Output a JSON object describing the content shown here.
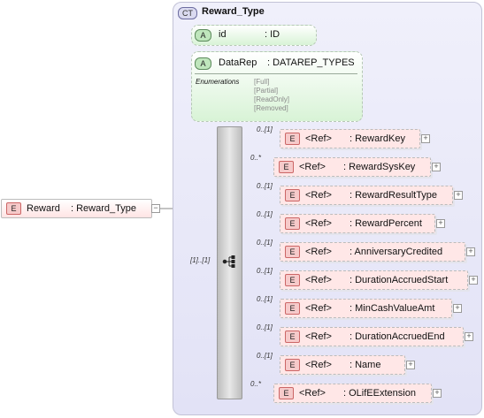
{
  "complex_type": {
    "badge": "CT",
    "name": "Reward_Type"
  },
  "root_element": {
    "badge": "E",
    "name": "Reward",
    "type": ": Reward_Type"
  },
  "attributes": [
    {
      "badge": "A",
      "name": "id",
      "type": ": ID"
    },
    {
      "badge": "A",
      "name": "DataRep",
      "type": ": DATAREP_TYPES",
      "enumerations_label": "Enumerations",
      "enumerations": [
        "[Full]",
        "[Partial]",
        "[ReadOnly]",
        "[Removed]"
      ]
    }
  ],
  "sequence": {
    "multiplicity": "[1]..[1]",
    "icon": "sequence-icon"
  },
  "elements": [
    {
      "mult": "0..[1]",
      "ref": "<Ref>",
      "name": ": RewardKey"
    },
    {
      "mult": "0..*",
      "ref": "<Ref>",
      "name": ": RewardSysKey"
    },
    {
      "mult": "0..[1]",
      "ref": "<Ref>",
      "name": ": RewardResultType"
    },
    {
      "mult": "0..[1]",
      "ref": "<Ref>",
      "name": ": RewardPercent"
    },
    {
      "mult": "0..[1]",
      "ref": "<Ref>",
      "name": ": AnniversaryCredited"
    },
    {
      "mult": "0..[1]",
      "ref": "<Ref>",
      "name": ": DurationAccruedStart"
    },
    {
      "mult": "0..[1]",
      "ref": "<Ref>",
      "name": ": MinCashValueAmt"
    },
    {
      "mult": "0..[1]",
      "ref": "<Ref>",
      "name": ": DurationAccruedEnd"
    },
    {
      "mult": "0..[1]",
      "ref": "<Ref>",
      "name": ": Name"
    },
    {
      "mult": "0..*",
      "ref": "<Ref>",
      "name": ": OLifEExtension"
    }
  ],
  "element_badge": "E",
  "expand_glyph": "+",
  "collapse_glyph": "−"
}
